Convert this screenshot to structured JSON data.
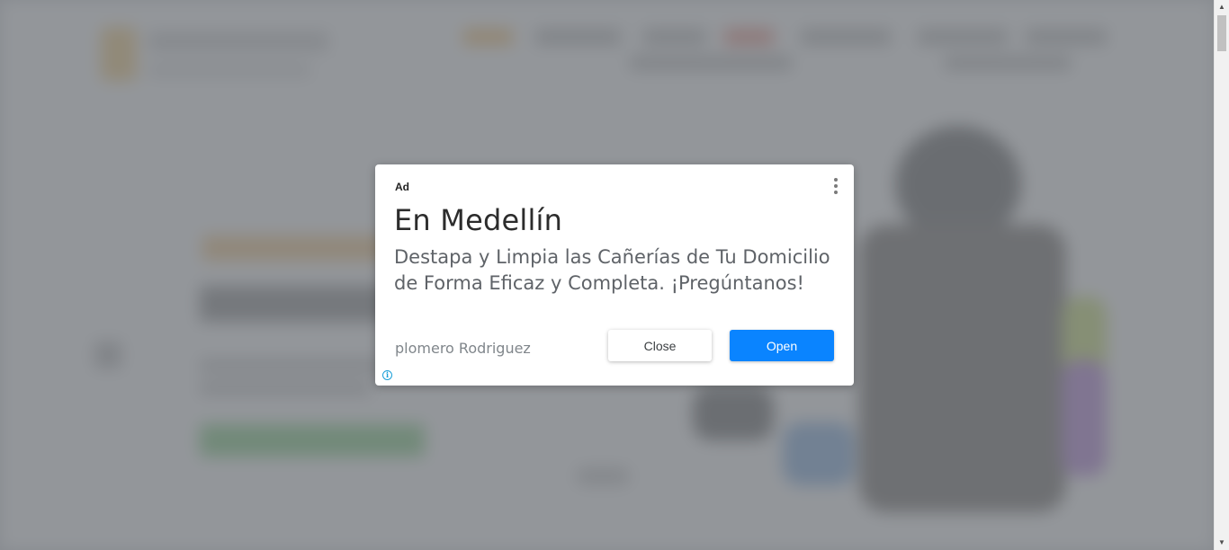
{
  "ad": {
    "label": "Ad",
    "title": "En Medellín",
    "description": "Destapa y Limpia las Cañerías de Tu Domicilio de Forma Eficaz y Completa. ¡Pregúntanos!",
    "advertiser": "plomero Rodriguez",
    "close_label": "Close",
    "open_label": "Open",
    "icons": {
      "menu": "more-vertical-icon",
      "info": "info-icon"
    }
  },
  "colors": {
    "open_button": "#0a84ff",
    "info_icon": "#1a9fd8",
    "overlay": "#787c82"
  },
  "scrollbar": {
    "up_arrow": "▲",
    "down_arrow": "▼"
  }
}
